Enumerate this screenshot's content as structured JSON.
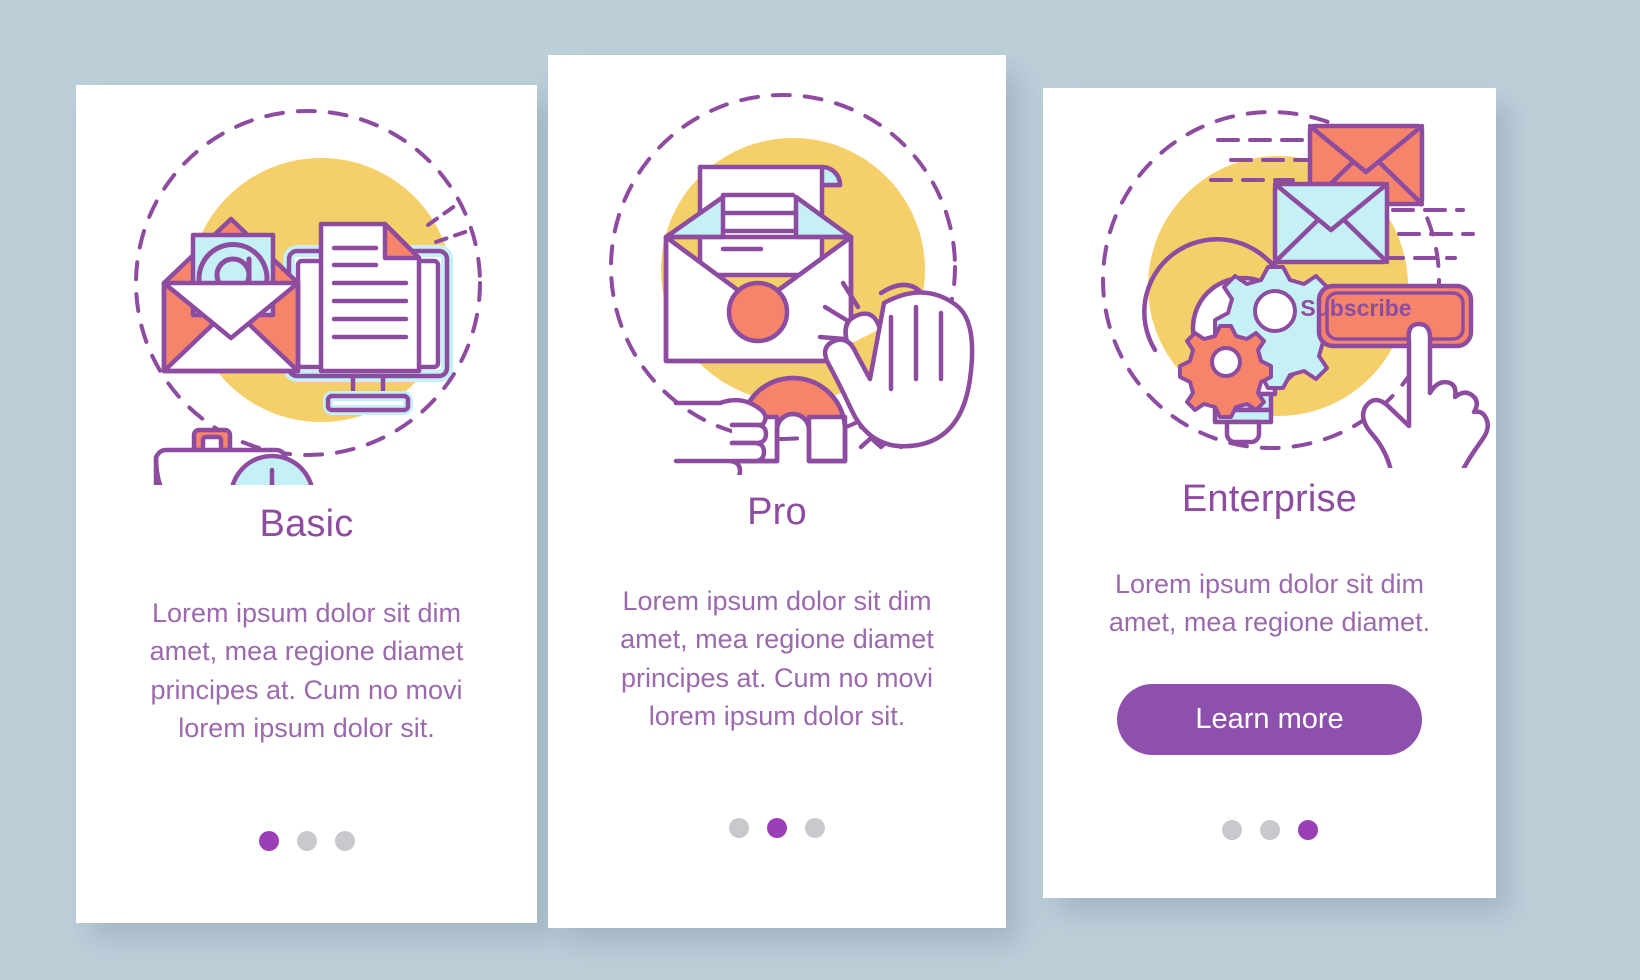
{
  "theme": {
    "background": "#bdd0da",
    "card_background": "#ffffff",
    "outline_purple": "#8e4ca0",
    "title_purple": "#8e4ca0",
    "body_purple": "#9b6aad",
    "accent_coral": "#f5846b",
    "accent_cyan": "#c5f0f5",
    "accent_yellow": "#f5d06a",
    "button_purple": "#8e50ad",
    "dot_active": "#9a3fb5",
    "dot_inactive": "#c9c9cd"
  },
  "cards": [
    {
      "title": "Basic",
      "description": "Lorem ipsum dolor sit dim amet, mea regione diamet principes at. Cum no movi lorem ipsum dolor sit.",
      "illustration": "email-document-briefcase-clock",
      "dots": {
        "count": 3,
        "active_index": 0
      },
      "cta": null
    },
    {
      "title": "Pro",
      "description": "Lorem ipsum dolor sit dim amet, mea regione diamet principes at. Cum no movi lorem ipsum dolor sit.",
      "illustration": "envelope-magnet-stop-hand",
      "dots": {
        "count": 3,
        "active_index": 1
      },
      "cta": null
    },
    {
      "title": "Enterprise",
      "description": "Lorem ipsum dolor sit dim amet, mea regione diamet.",
      "illustration": "envelopes-lightbulb-gears-subscribe",
      "dots": {
        "count": 3,
        "active_index": 2
      },
      "cta": {
        "label": "Learn more"
      },
      "subscribe_button_label": "Subscribe"
    }
  ],
  "illustration_labels": {
    "at_symbol": "@",
    "subscribe": "Subscribe"
  }
}
